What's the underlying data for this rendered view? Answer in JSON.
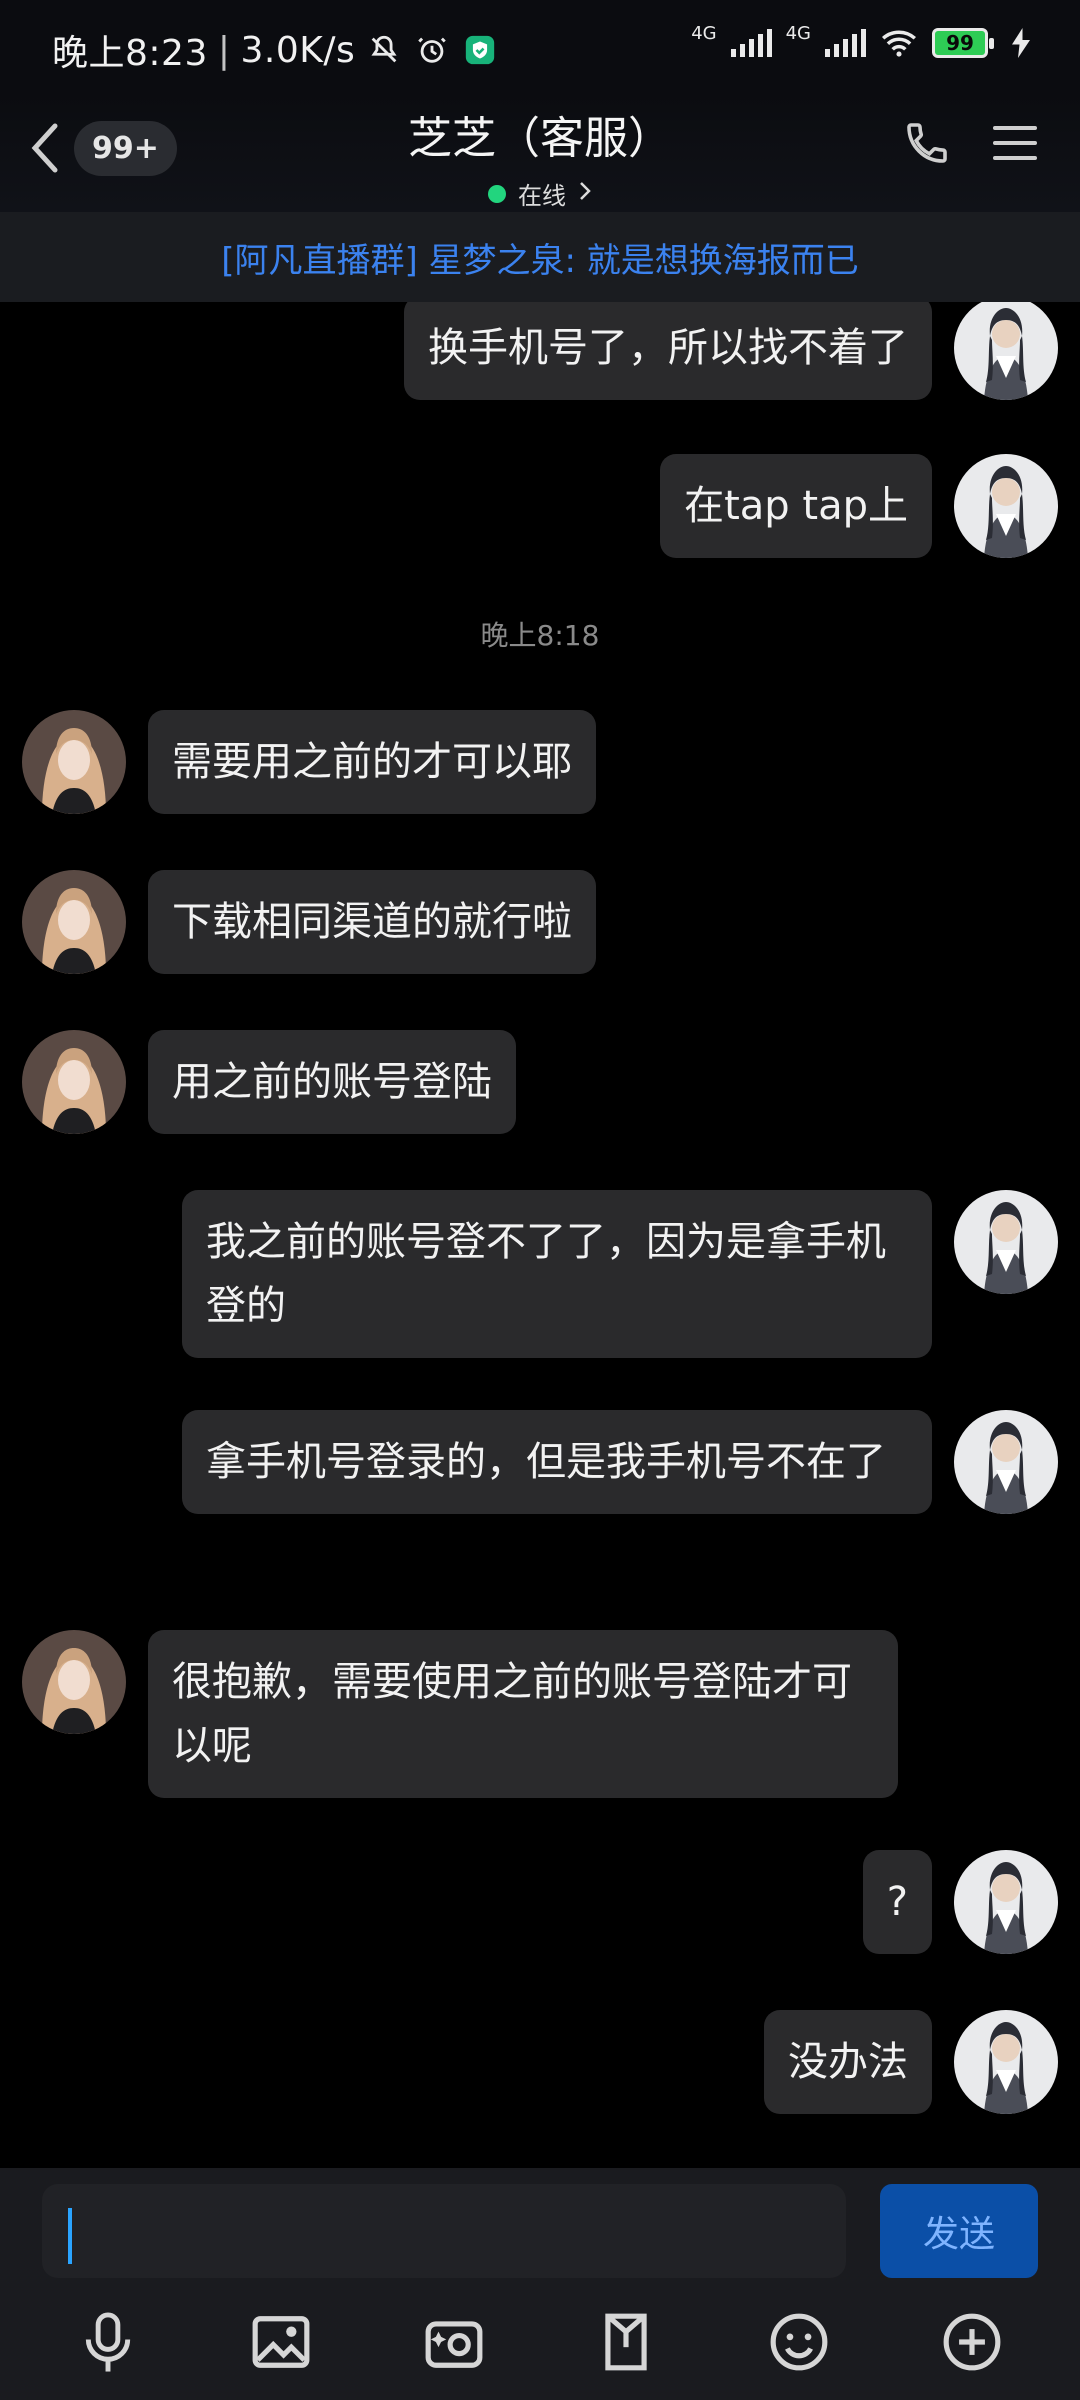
{
  "status_bar": {
    "time": "晚上8:23",
    "network_speed": "3.0K/s",
    "signal_label_1": "4G",
    "signal_label_2": "4G",
    "battery": "99",
    "icons": [
      "mute-bell-icon",
      "alarm-icon",
      "shield-icon",
      "wifi-icon",
      "charging-bolt-icon"
    ]
  },
  "header": {
    "unread_badge": "99+",
    "title": "芝芝（客服）",
    "presence": "在线",
    "presence_color": "#22d57e",
    "icons": [
      "back-chevron-icon",
      "phone-icon",
      "menu-icon"
    ]
  },
  "announcement": {
    "text": "[阿凡直播群] 星梦之泉: 就是想换海报而已",
    "color": "#3b82ef"
  },
  "chat": {
    "timestamp": "晚上8:18",
    "messages": [
      {
        "side": "out",
        "text": "换手机号了，所以找不着了"
      },
      {
        "side": "out",
        "text": "在tap tap上"
      },
      {
        "side": "in",
        "text": "需要用之前的才可以耶"
      },
      {
        "side": "in",
        "text": "下载相同渠道的就行啦"
      },
      {
        "side": "in",
        "text": "用之前的账号登陆"
      },
      {
        "side": "out",
        "text": "我之前的账号登不了了，因为是拿手机登的"
      },
      {
        "side": "out",
        "text": "拿手机号登录的，但是我手机号不在了"
      },
      {
        "side": "in",
        "text": "很抱歉，需要使用之前的账号登陆才可以呢"
      },
      {
        "side": "out",
        "text": "?"
      },
      {
        "side": "out",
        "text": "没办法"
      }
    ]
  },
  "composer": {
    "input_value": "",
    "send_label": "发送",
    "tools": [
      "microphone-icon",
      "image-icon",
      "camera-icon",
      "file-icon",
      "emoji-icon",
      "plus-icon"
    ]
  }
}
